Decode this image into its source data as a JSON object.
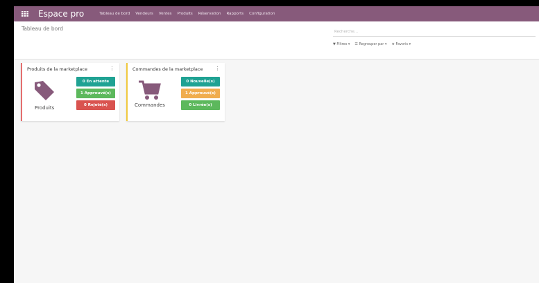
{
  "navbar": {
    "brand": "Espace pro",
    "menu": [
      "Tableau de bord",
      "Vendeurs",
      "Ventes",
      "Produits",
      "Réservation",
      "Rapports",
      "Configuration"
    ]
  },
  "control_panel": {
    "breadcrumb": "Tableau de bord",
    "search_placeholder": "Recherche...",
    "filters_label": "▼ Filtres ▾",
    "group_by_label": "☰ Regrouper par ▾",
    "favorites_label": "★ Favoris ▾"
  },
  "tiles": [
    {
      "title": "Produits de la marketplace",
      "caption": "Produits",
      "buttons": [
        "0 En attente",
        "1 Approuvé(s)",
        "0 Rejeté(s)"
      ],
      "accent": "#e46f6f"
    },
    {
      "title": "Commandes de la marketplace",
      "caption": "Commandes",
      "buttons": [
        "0 Nouvelle(s)",
        "1 Approuvé(s)",
        "0 Livrée(s)"
      ],
      "accent": "#f0c93e"
    }
  ],
  "colors": {
    "navbar": "#875a7b",
    "icon": "#875a7b",
    "teal": "#1fa293",
    "green": "#5cb85c",
    "orange": "#f0ad4e",
    "red": "#d9534f"
  },
  "icons": {
    "apps": "apps-grid-icon",
    "products": "tag-icon",
    "orders": "shopping-cart-icon"
  }
}
